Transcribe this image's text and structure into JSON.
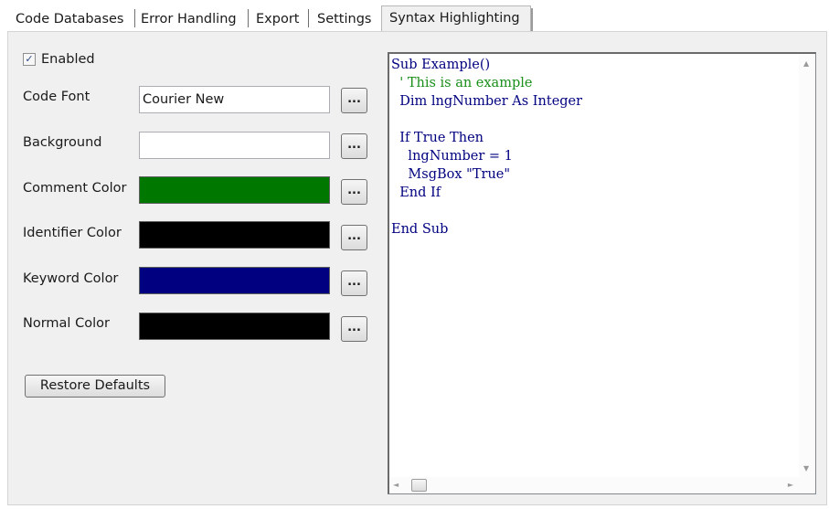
{
  "tabs": [
    {
      "label": "Code Databases"
    },
    {
      "label": "Error Handling"
    },
    {
      "label": "Export"
    },
    {
      "label": "Settings"
    },
    {
      "label": "Syntax Highlighting"
    }
  ],
  "enabled": {
    "label": "Enabled",
    "checked": true,
    "check_glyph": "✓"
  },
  "code_font": {
    "label": "Code Font",
    "value": "Courier New"
  },
  "background": {
    "label": "Background",
    "value": ""
  },
  "colors": [
    {
      "label": "Comment Color",
      "color": "#007800"
    },
    {
      "label": "Identifier Color",
      "color": "#000000"
    },
    {
      "label": "Keyword Color",
      "color": "#000080"
    },
    {
      "label": "Normal Color",
      "color": "#000000"
    }
  ],
  "ellipsis_label": "...",
  "restore_label": "Restore Defaults",
  "code": {
    "keyword_color": "#000080",
    "comment_color": "#1a8f1a",
    "lines": [
      "Sub Example()",
      "  ' This is an example",
      "  Dim lngNumber As Integer",
      "",
      "  If True Then",
      "    lngNumber = 1",
      "    MsgBox \"True\"",
      "  End If",
      "",
      "End Sub"
    ]
  },
  "scroll": {
    "up": "▲",
    "down": "▼",
    "left": "◄",
    "right": "►"
  }
}
